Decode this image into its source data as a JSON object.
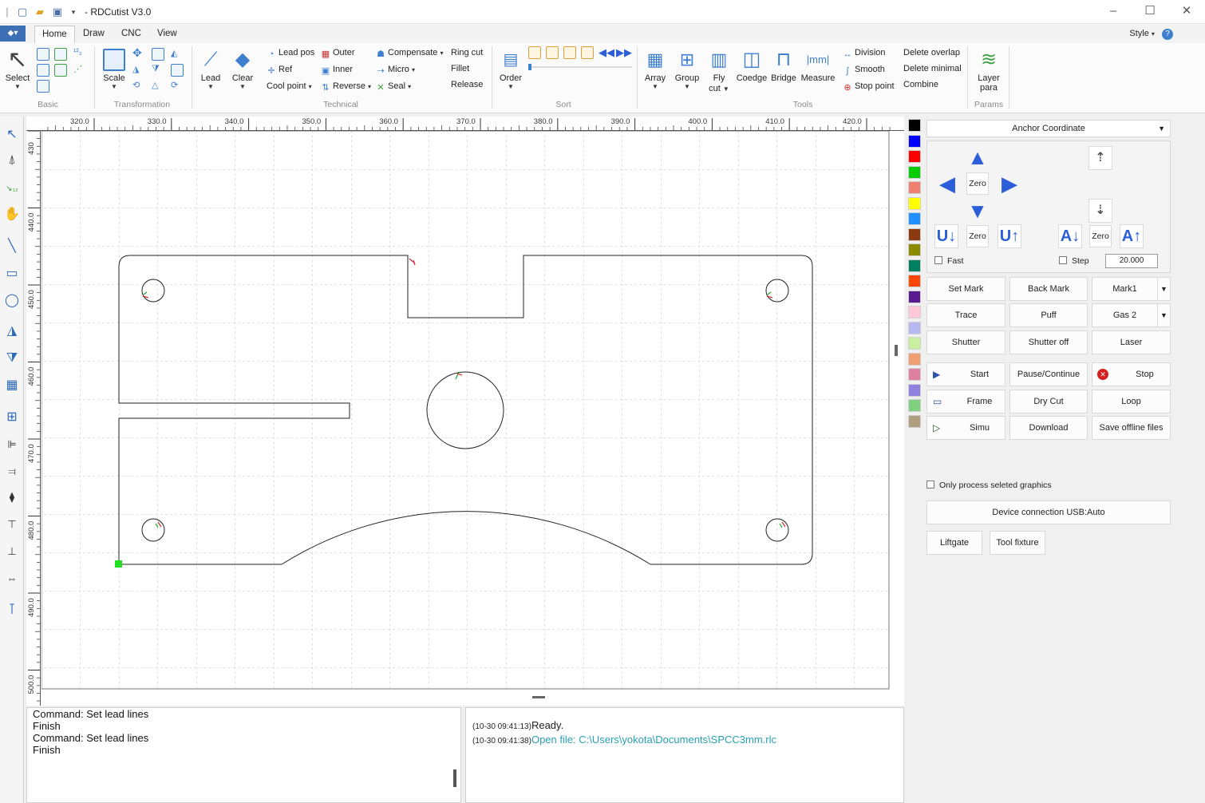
{
  "window": {
    "title": "- RDCutist V3.0"
  },
  "tabs": [
    "Home",
    "Draw",
    "CNC",
    "View"
  ],
  "style_menu": "Style",
  "ribbon": {
    "groups": {
      "basic": "Basic",
      "transformation": "Transformation",
      "technical": "Technical",
      "sort": "Sort",
      "tools": "Tools",
      "params": "Params"
    },
    "select": "Select",
    "scale": "Scale",
    "lead": "Lead",
    "clear": "Clear",
    "lead_pos": "Lead pos",
    "ref": "Ref",
    "cool_point": "Cool point",
    "outer": "Outer",
    "inner": "Inner",
    "reverse": "Reverse",
    "compensate": "Compensate",
    "micro": "Micro",
    "seal": "Seal",
    "ring_cut": "Ring cut",
    "fillet": "Fillet",
    "release": "Release",
    "order": "Order",
    "array": "Array",
    "group": "Group",
    "fly_cut_1": "Fly",
    "fly_cut_2": "cut",
    "coedge": "Coedge",
    "bridge": "Bridge",
    "measure": "Measure",
    "division": "Division",
    "smooth": "Smooth",
    "stop_point": "Stop point",
    "delete_overlap": "Delete overlap",
    "delete_minimal": "Delete minimal",
    "combine": "Combine",
    "layer_para_1": "Layer",
    "layer_para_2": "para"
  },
  "ruler": {
    "h_labels": [
      "320.0",
      "330.0",
      "340.0",
      "350.0",
      "360.0",
      "370.0",
      "380.0",
      "390.0",
      "400.0",
      "410.0",
      "420.0"
    ],
    "v_labels": [
      "430",
      "440.0",
      "450.0",
      "460.0",
      "470.0",
      "480.0",
      "490.0",
      "500.0"
    ]
  },
  "command_log": [
    "Command: Set lead lines",
    "Finish",
    "Command: Set lead lines",
    "Finish"
  ],
  "status_log": [
    {
      "time": "(10-30 09:41:13)",
      "text": "Ready.",
      "link": false
    },
    {
      "time": "(10-30 09:41:38)",
      "text": "Open file: C:\\Users\\yokota\\Documents\\SPCC3mm.rlc",
      "link": true
    }
  ],
  "palette": [
    "#000000",
    "#0000ff",
    "#ff0000",
    "#00cc00",
    "#f08070",
    "#ffff00",
    "#1e90ff",
    "#8b3a10",
    "#8b8b00",
    "#008060",
    "#ff4500",
    "#5a1a90",
    "#ffc8d8",
    "#b8b8f0",
    "#c8f0a0",
    "#f0a070",
    "#e080a0",
    "#9080e0",
    "#80d080",
    "#b0a080"
  ],
  "panel": {
    "anchor": "Anchor Coordinate",
    "zero": "Zero",
    "fast": "Fast",
    "step": "Step",
    "step_value": "20.000",
    "set_mark": "Set Mark",
    "back_mark": "Back Mark",
    "mark1": "Mark1",
    "trace": "Trace",
    "puff": "Puff",
    "gas2": "Gas 2",
    "shutter": "Shutter",
    "shutter_off": "Shutter off",
    "laser": "Laser",
    "start": "Start",
    "pause": "Pause/Continue",
    "stop": "Stop",
    "frame": "Frame",
    "dry_cut": "Dry Cut",
    "loop": "Loop",
    "simu": "Simu",
    "download": "Download",
    "save_offline": "Save offline files",
    "only_process": "Only process seleted graphics",
    "device_conn": "Device connection USB:Auto",
    "liftgate": "Liftgate",
    "tool_fixture": "Tool fixture"
  }
}
